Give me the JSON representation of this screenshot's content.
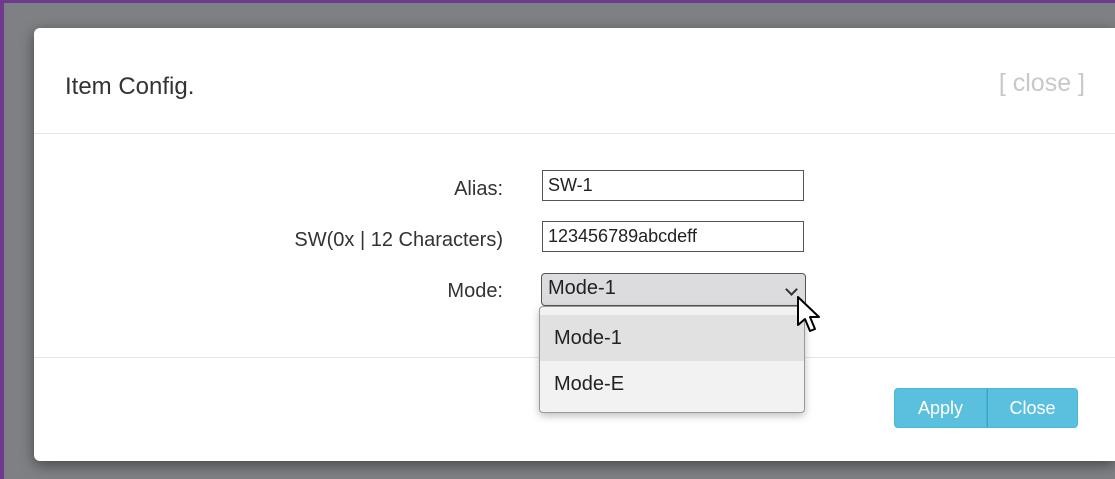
{
  "modal": {
    "title": "Item Config.",
    "close_link": "[ close ]"
  },
  "form": {
    "alias": {
      "label": "Alias:",
      "value": "SW-1"
    },
    "sw": {
      "label": "SW(0x | 12 Characters)",
      "value": "123456789abcdeff"
    },
    "mode": {
      "label": "Mode:",
      "selected": "Mode-1",
      "options": [
        "Mode-1",
        "Mode-E"
      ],
      "highlighted": "Mode-1"
    }
  },
  "footer": {
    "apply_label": "Apply",
    "close_label": "Close"
  },
  "colors": {
    "frame": "#6d3a8f",
    "button": "#5bc0de",
    "overlay": "#7e8084"
  },
  "icons": {
    "select_arrow": "chevron-down-icon",
    "cursor": "mouse-pointer-icon"
  }
}
